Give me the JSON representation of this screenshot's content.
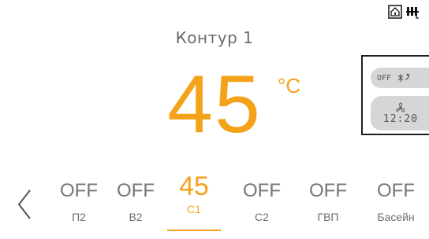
{
  "status_icons": [
    "house-flame-icon",
    "radiator-icon"
  ],
  "title": "Контур 1",
  "temperature": {
    "value": "45",
    "unit": "°C"
  },
  "side_panel": {
    "mode_text": "OFF",
    "mode_icon": "snowflake-sun-icon",
    "schedule_icon": "fan-icon",
    "schedule_time": "12:20"
  },
  "tabs": [
    {
      "value": "OFF",
      "label": "П2"
    },
    {
      "value": "OFF",
      "label": "В2"
    },
    {
      "value": "45",
      "label": "С1"
    },
    {
      "value": "OFF",
      "label": "С2"
    },
    {
      "value": "OFF",
      "label": "ГВП"
    },
    {
      "value": "OFF",
      "label": "Басейн"
    }
  ],
  "active_tab": "С1",
  "colors": {
    "accent": "#f5a21b",
    "text_grey": "#6b6b6b",
    "pill_bg": "#d6d6d6"
  }
}
